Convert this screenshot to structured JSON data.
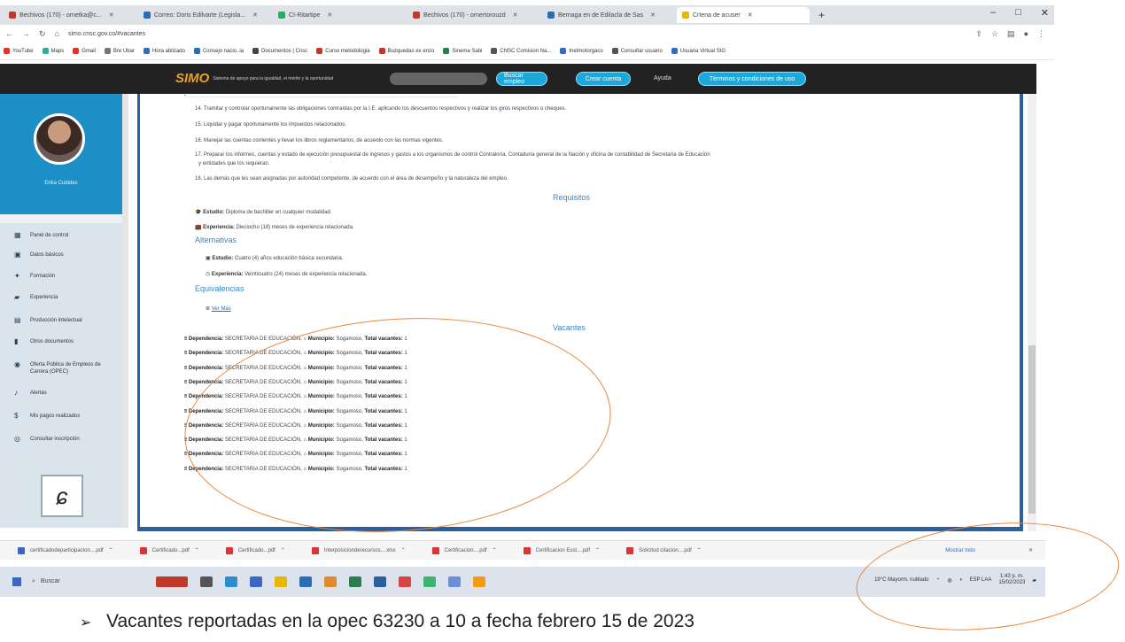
{
  "browser": {
    "tabs": [
      {
        "label": "Bechivos (170) - ornetka@c...",
        "color": "#c0392b",
        "active": false
      },
      {
        "label": "Correo: Doris Edilvarte (Legisla...",
        "color": "#2a6db5",
        "active": false
      },
      {
        "label": "CI-Ritartipe",
        "color": "#27ae60",
        "active": false
      },
      {
        "label": "Bechivos (170) - ornertorouzd",
        "color": "#c0392b",
        "active": false
      },
      {
        "label": "Bernaga en de Edilacla de Sas",
        "color": "#2a6db5",
        "active": false
      },
      {
        "label": "Crtena de acuser",
        "color": "#e6b800",
        "active": true
      }
    ],
    "url": "simo.cnsc.gov.co/#vacantes",
    "bookmarks": [
      "YouTube",
      "Maps",
      "Gmail",
      "Bre Ubar",
      "Hora ablizado",
      "Consejo nacio..ia",
      "Documentos | Cnsc",
      "Curso metodologia",
      "Buzquedas ex enzo",
      "Sinema Sabi",
      "CNSC Comision Na...",
      "Inetmotorgaco",
      "Consultar usuario",
      "Usuaria Virtual SIG"
    ]
  },
  "header": {
    "logo_mark": "SIMO",
    "logo_text": "Sistema de apoyo para la igualdad, el mérito y la oportunidad",
    "search_button": "Buscar empleo",
    "account_button": "Crear cuenta",
    "help_link": "Ayuda",
    "terms_button": "Términos y condiciones de uso"
  },
  "sidebar": {
    "user_name": "Erika Cubides",
    "menu": [
      {
        "label": "Panel de control",
        "icon": "grid-icon"
      },
      {
        "label": "Datos básicos",
        "icon": "user-id-icon"
      },
      {
        "label": "Formación",
        "icon": "graduation-icon"
      },
      {
        "label": "Experiencia",
        "icon": "briefcase-icon"
      },
      {
        "label": "Producción intelectual",
        "icon": "book-icon"
      },
      {
        "label": "Otros documentos",
        "icon": "file-icon"
      },
      {
        "label": "Oferta Pública de Empleos de Carrera (OPEC)",
        "icon": "globe-icon"
      },
      {
        "label": "Alertas",
        "icon": "bell-icon"
      },
      {
        "label": "Mis pagos realizados",
        "icon": "dollar-icon"
      },
      {
        "label": "Consultar inscripción",
        "icon": "search-doc-icon"
      }
    ]
  },
  "content": {
    "functions": [
      "14. Tramitar y controlar oportunamente las obligaciones contraídas por la I.E. aplicando los descuentos respectivos y realizar los giros respectivos o cheques.",
      "15. Liquidar y pagar oportunamente los impuestos relacionados.",
      "16. Manejar las cuentas corrientes y llevar los libros reglamentarios, de acuerdo con las normas vigentes.",
      "17. Preparar los informes, cuentas y estado de ejecución presupuestal de ingresos y gastos a los organismos de control Contraloría, Contaduría general de la Nación y oficina de contabilidad de Secretaría de Educación",
      "y entidades que los requieran.",
      "18. Las demás que les sean asignadas por autoridad competente, de acuerdo con el área de desempeño y la naturaleza del empleo."
    ],
    "requisitos_title": "Requisitos",
    "estudio_label": "Estudio:",
    "estudio_value": "Diploma de bachiller en cualquier modalidad.",
    "experiencia_label": "Experiencia:",
    "experiencia_value": "Dieciocho (18) meses de experiencia relacionada.",
    "alternativas_title": "Alternativas",
    "alt_estudio_label": "Estudio:",
    "alt_estudio_value": "Cuatro (4) años educación básica secundaria.",
    "alt_experiencia_label": "Experiencia:",
    "alt_experiencia_value": "Veinticuatro (24) meses de experiencia relacionada.",
    "equivalencias_title": "Equivalencias",
    "equivalencias_link": "Ver Más",
    "vacantes_title": "Vacantes",
    "vacantes": [
      {
        "dep_label": "Dependencia:",
        "dep": "SECRETARIA DE EDUCACIÓN,",
        "mun_label": "Municipio:",
        "mun": "Sogamoso,",
        "tot_label": "Total vacantes:",
        "tot": "1"
      },
      {
        "dep_label": "Dependencia:",
        "dep": "SECRETARIA DE EDUCACIÓN,",
        "mun_label": "Municipio:",
        "mun": "Sogamoso,",
        "tot_label": "Total vacantes:",
        "tot": "1"
      },
      {
        "dep_label": "Dependencia:",
        "dep": "SECRETARIA DE EDUCACIÓN,",
        "mun_label": "Municipio:",
        "mun": "Sogamoso,",
        "tot_label": "Total vacantes:",
        "tot": "1"
      },
      {
        "dep_label": "Dependencia:",
        "dep": "SECRETARIA DE EDUCACIÓN,",
        "mun_label": "Municipio:",
        "mun": "Sogamoso,",
        "tot_label": "Total vacantes:",
        "tot": "1"
      },
      {
        "dep_label": "Dependencia:",
        "dep": "SECRETARIA DE EDUCACIÓN,",
        "mun_label": "Municipio:",
        "mun": "Sogamoso,",
        "tot_label": "Total vacantes:",
        "tot": "1"
      },
      {
        "dep_label": "Dependencia:",
        "dep": "SECRETARIA DE EDUCACIÓN,",
        "mun_label": "Municipio:",
        "mun": "Sogamoso,",
        "tot_label": "Total vacantes:",
        "tot": "1"
      },
      {
        "dep_label": "Dependencia:",
        "dep": "SECRETARIA DE EDUCACIÓN,",
        "mun_label": "Municipio:",
        "mun": "Sogamoso,",
        "tot_label": "Total vacantes:",
        "tot": "1"
      },
      {
        "dep_label": "Dependencia:",
        "dep": "SECRETARIA DE EDUCACIÓN,",
        "mun_label": "Municipio:",
        "mun": "Sogamoso,",
        "tot_label": "Total vacantes:",
        "tot": "1"
      },
      {
        "dep_label": "Dependencia:",
        "dep": "SECRETARIA DE EDUCACIÓN,",
        "mun_label": "Municipio:",
        "mun": "Sogamoso,",
        "tot_label": "Total vacantes:",
        "tot": "1"
      },
      {
        "dep_label": "Dependencia:",
        "dep": "SECRETARIA DE EDUCACIÓN,",
        "mun_label": "Municipio:",
        "mun": "Sogamoso,",
        "tot_label": "Total vacantes:",
        "tot": "1"
      }
    ]
  },
  "downloads": {
    "items": [
      "certificadodeparticipacion....pdf",
      "Certificado...pdf",
      "Certificado...pdf",
      "Interposicionderecursos....xlsx",
      "Certificacion....pdf",
      "Certificacion Esst....pdf",
      "Solicitud citacion....pdf"
    ],
    "show_all": "Mostrar todo"
  },
  "taskbar": {
    "search_placeholder": "Buscar",
    "weather": "19°C Mayorm. nublado",
    "time": "1:43 p. m.",
    "date": "15/02/2023",
    "lang": "ESP LAA"
  },
  "caption": {
    "text": "Vacantes reportadas en la opec 63230 a 10 a fecha febrero 15 de 2023"
  },
  "colors": {
    "header_bg": "#222222",
    "accent": "#1ca8d8",
    "profile_bg": "#1d8fc7",
    "section_title": "#3a87c4",
    "frame": "#2a5fa0",
    "annotation": "#e8883a"
  }
}
